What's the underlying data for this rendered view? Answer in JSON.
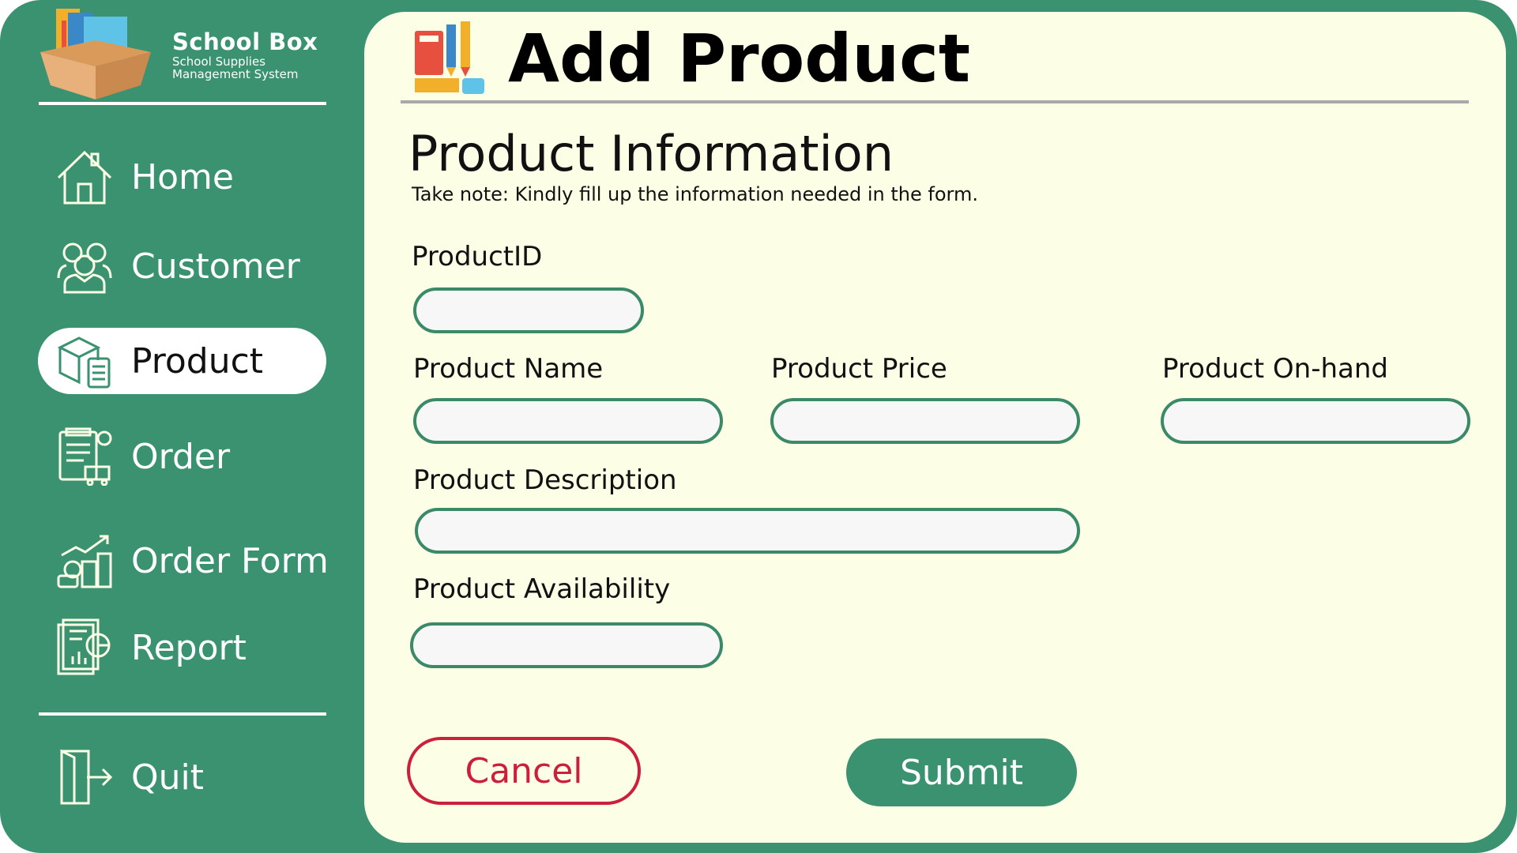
{
  "app": {
    "logo_title": "School Box",
    "logo_subtitle_line1": "School Supplies",
    "logo_subtitle_line2": "Management System",
    "accent_color": "#3a9270",
    "panel_color": "#fdfee6",
    "cancel_color": "#cc1f3b"
  },
  "sidebar": {
    "items": [
      {
        "label": "Home",
        "icon": "home-icon",
        "active": false
      },
      {
        "label": "Customer",
        "icon": "customers-icon",
        "active": false
      },
      {
        "label": "Product",
        "icon": "product-box-icon",
        "active": true
      },
      {
        "label": "Order",
        "icon": "order-clipboard-icon",
        "active": false
      },
      {
        "label": "Order Form",
        "icon": "coins-growth-icon",
        "active": false
      },
      {
        "label": "Report",
        "icon": "report-chart-icon",
        "active": false
      }
    ],
    "quit": {
      "label": "Quit",
      "icon": "exit-door-icon"
    }
  },
  "main": {
    "title": "Add Product",
    "header_icon": "school-supplies-icon",
    "section_title": "Product Information",
    "note": "Take note: Kindly fill up the information needed in the form.",
    "fields": {
      "product_id": {
        "label": "ProductID",
        "value": ""
      },
      "product_name": {
        "label": "Product Name",
        "value": ""
      },
      "product_price": {
        "label": "Product Price",
        "value": ""
      },
      "product_onhand": {
        "label": "Product On-hand",
        "value": ""
      },
      "product_description": {
        "label": "Product Description",
        "value": ""
      },
      "product_availability": {
        "label": "Product Availability",
        "value": ""
      }
    },
    "cancel_label": "Cancel",
    "submit_label": "Submit"
  }
}
